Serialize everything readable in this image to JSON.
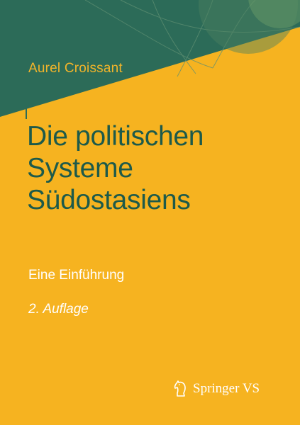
{
  "book": {
    "author": "Aurel Croissant",
    "title_lines": [
      "Die politischen",
      "Systeme",
      "Südostasiens"
    ],
    "subtitle": "Eine Einführung",
    "edition": "2. Auflage"
  },
  "publisher": {
    "name": "Springer VS",
    "logo_icon": "horse-chess-icon"
  },
  "colors": {
    "background_yellow": "#f6b320",
    "band_green": "#2c6b58",
    "title_green": "#1d5a4a",
    "text_white": "#ffffff"
  }
}
